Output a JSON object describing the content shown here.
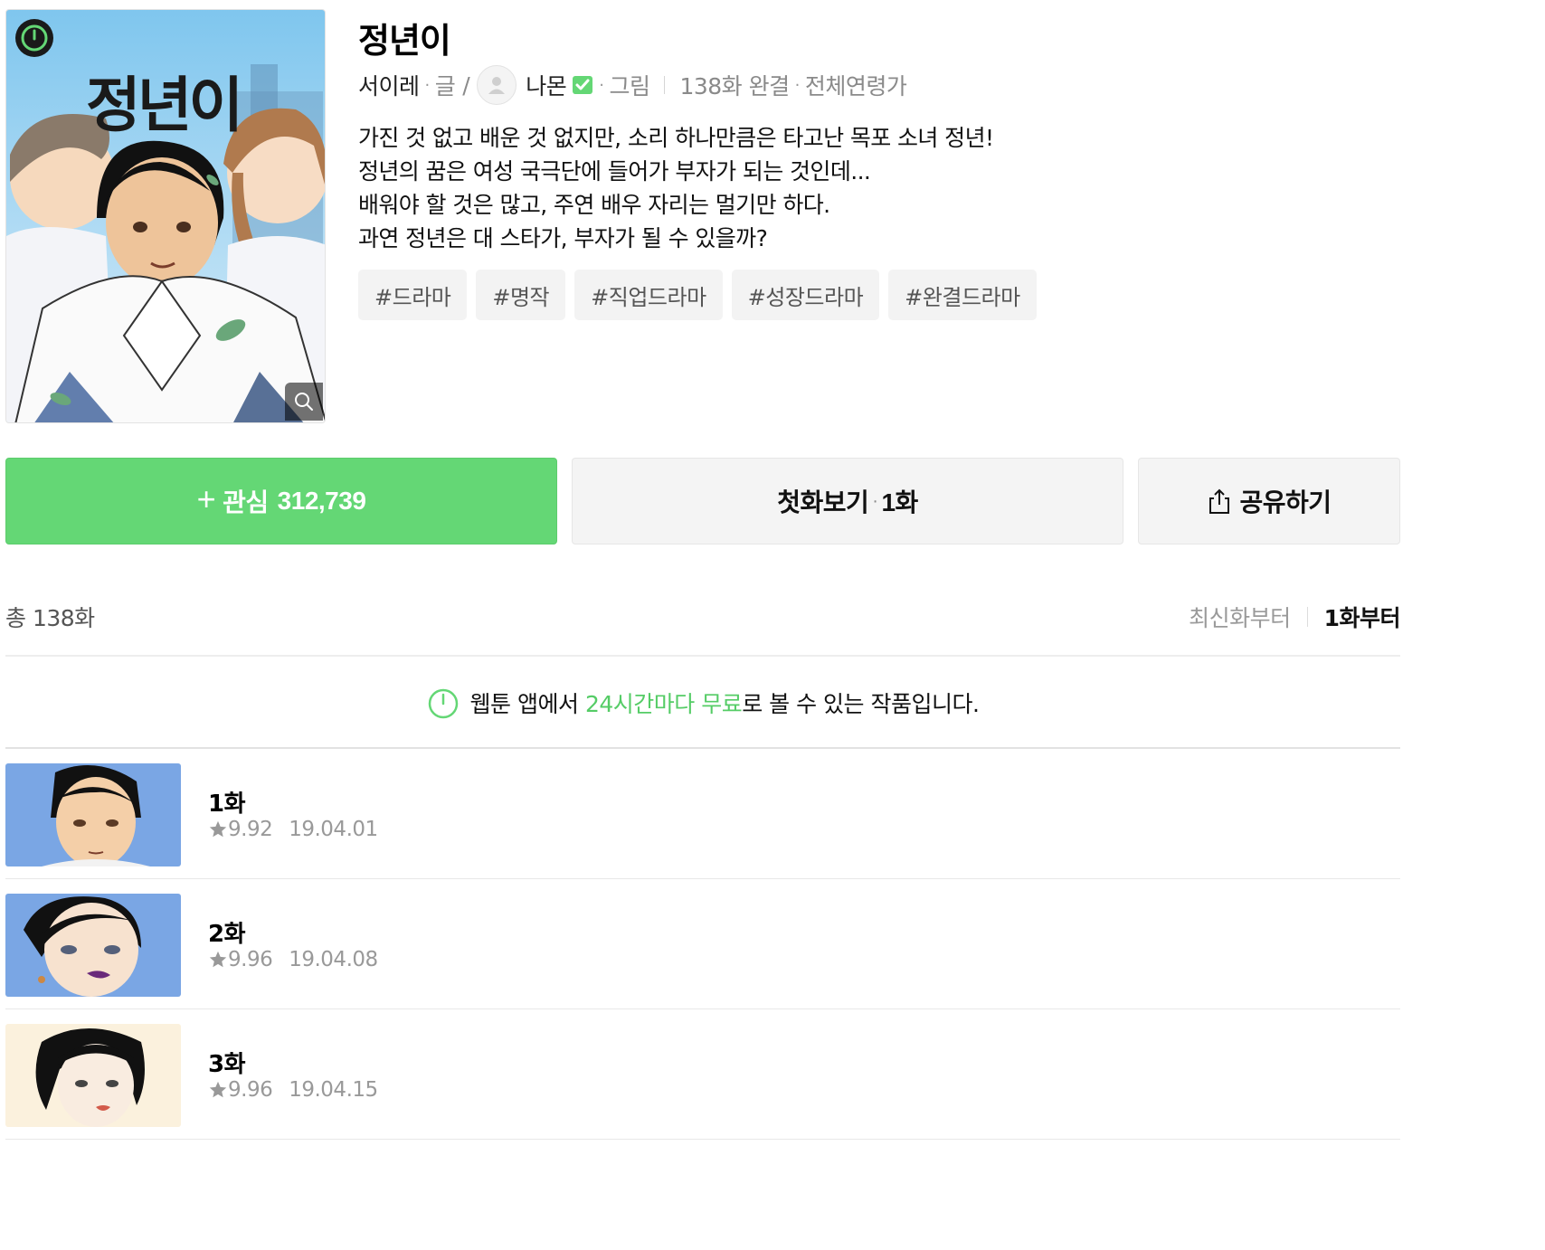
{
  "series": {
    "title": "정년이",
    "cover_title": "정년이",
    "writer": "서이레",
    "writer_role": "글",
    "slash": "/",
    "artist": "나몬",
    "artist_role": "그림",
    "episodes_status": "138화 완결",
    "age_rating": "전체연령가",
    "description": [
      "가진 것 없고 배운 것 없지만, 소리 하나만큼은 타고난 목포 소녀 정년!",
      "정년의 꿈은 여성 국극단에 들어가 부자가 되는 것인데...",
      "배워야 할 것은 많고, 주연 배우 자리는 멀기만 하다.",
      "과연 정년은 대 스타가, 부자가 될 수 있을까?"
    ],
    "tags": [
      "#드라마",
      "#명작",
      "#직업드라마",
      "#성장드라마",
      "#완결드라마"
    ]
  },
  "actions": {
    "favorite_plus": "+",
    "favorite_label": "관심",
    "favorite_count": "312,739",
    "first_label": "첫화보기",
    "first_episode": "1화",
    "share_label": "공유하기"
  },
  "list": {
    "total": "총 138화",
    "sort_latest": "최신화부터",
    "sort_first": "1화부터",
    "notice_pre": "웹툰 앱에서 ",
    "notice_highlight": "24시간마다 무료",
    "notice_post": "로 볼 수 있는 작품입니다.",
    "episodes": [
      {
        "title": "1화",
        "rating": "9.92",
        "date": "19.04.01",
        "thumb_bg": "#7aa6e4"
      },
      {
        "title": "2화",
        "rating": "9.96",
        "date": "19.04.08",
        "thumb_bg": "#7aa6e4"
      },
      {
        "title": "3화",
        "rating": "9.96",
        "date": "19.04.15",
        "thumb_bg": "#fbf1dd"
      }
    ]
  },
  "colors": {
    "accent_green": "#64d775",
    "highlight_green": "#55cc66",
    "tag_bg": "#f3f3f3",
    "button_bg": "#f4f4f4"
  },
  "icons": {
    "cover_badge": "timer-icon",
    "cover_zoom": "zoom-icon",
    "author_avatar": "avatar-icon",
    "verified": "verified-check-icon",
    "share": "share-icon",
    "notice": "timer-icon",
    "rating": "star-icon"
  }
}
